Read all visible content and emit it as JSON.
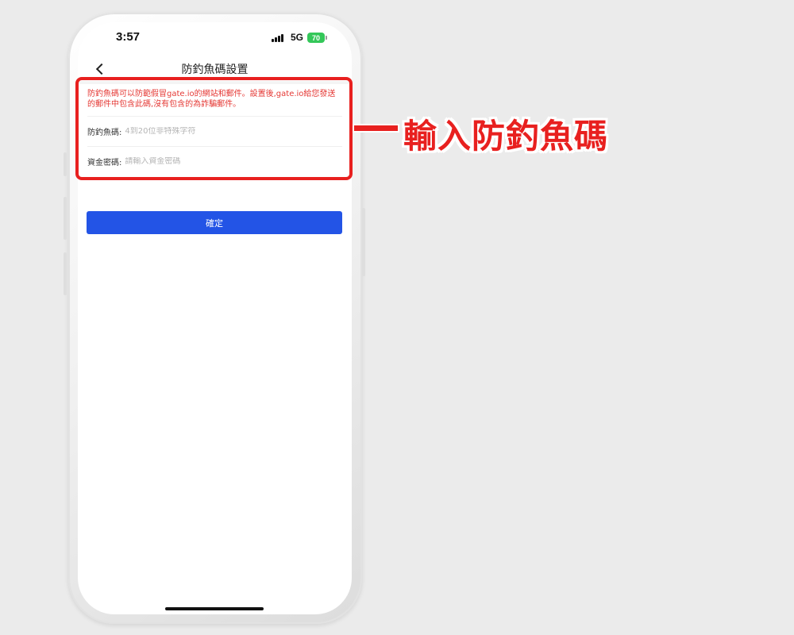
{
  "status_bar": {
    "time": "3:57",
    "network": "5G",
    "battery": "70"
  },
  "header": {
    "title": "防釣魚碼設置",
    "back_icon": "chevron-left-icon"
  },
  "form": {
    "notice": "防釣魚碼可以防範假冒gate.io的網站和郵件。設置後,gate.io給您發送的郵件中包含此碼,沒有包含的為詐騙郵件。",
    "anti_phishing": {
      "label": "防釣魚碼:",
      "placeholder": "4到20位非特殊字符",
      "value": ""
    },
    "fund_password": {
      "label": "資金密碼:",
      "placeholder": "請輸入資金密碼",
      "value": ""
    },
    "confirm_label": "確定"
  },
  "annotation": {
    "text": "輸入防釣魚碼"
  },
  "colors": {
    "accent": "#2354e6",
    "notice_text": "#e53935",
    "annotation": "#e8201f",
    "battery": "#34c759"
  }
}
